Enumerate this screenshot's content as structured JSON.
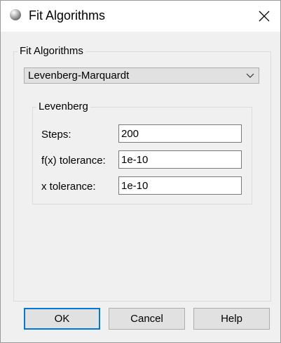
{
  "window": {
    "title": "Fit Algorithms",
    "icon": "app-globe-icon",
    "close_icon": "close-icon"
  },
  "outer_group": {
    "legend": "Fit Algorithms",
    "algorithm_select": {
      "value": "Levenberg-Marquardt",
      "arrow_icon": "chevron-down-icon"
    }
  },
  "inner_group": {
    "legend": "Levenberg",
    "fields": {
      "steps": {
        "label": "Steps:",
        "value": "200"
      },
      "fx_tolerance": {
        "label": "f(x) tolerance:",
        "value": "1e-10"
      },
      "x_tolerance": {
        "label": "x tolerance:",
        "value": "1e-10"
      }
    }
  },
  "buttons": {
    "ok": "OK",
    "cancel": "Cancel",
    "help": "Help"
  },
  "colors": {
    "dialog_bg": "#f0f0f0",
    "focus_border": "#0078d7",
    "button_bg": "#e1e1e1"
  }
}
